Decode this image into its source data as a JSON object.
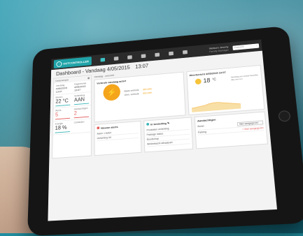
{
  "app": {
    "logo_text": "OUTCONTROLLER",
    "user_name": "Welkom Jeremy",
    "user_sub": "Family Manager",
    "search_placeholder": "Zoekveld"
  },
  "title": {
    "text": "Dashboard - Vandaag 4/05/2015",
    "time": "13:07"
  },
  "left": {
    "header": "Onderwerpen",
    "cells": [
      {
        "label": "Vandaag",
        "value": "4/05/2015 13:07"
      },
      {
        "label": "Dagschema",
        "value": "4/05/2015 13:07"
      },
      {
        "label": "Binnen",
        "value": "22 °C"
      },
      {
        "label": "Verlichting",
        "value": "AAN"
      },
      {
        "label": "Alerts",
        "value": "5"
      },
      {
        "label": "Aandachtigen",
        "value": "2"
      },
      {
        "label": "Energie",
        "value": "18 %"
      },
      {
        "label": "Contacten",
        "value": ""
      }
    ]
  },
  "main": {
    "header_left": "Vandaag - overzicht",
    "energy": {
      "title": "Verbruik vandaag actief",
      "row1_label": "Basis verbruik",
      "row1_value": "350 kWh",
      "row2_label": "Gem. verbruik",
      "row2_value": "590 kWh"
    },
    "weather": {
      "title": "Weerbericht 4/05/2015 13:07",
      "temp": "18",
      "desc": "Vandaag een ietwat bewolkte dag met zon"
    },
    "alerts": {
      "title": "Nieuwe alerts",
      "items": [
        "Alarm 1 Actief",
        "Verlichting Uit"
      ]
    },
    "settings": {
      "title": "In bestelling",
      "items": [
        "Produkten verlichting",
        "Package status",
        "Boodschap",
        "Winkelwacht afhaalpunt"
      ]
    },
    "notices": {
      "title": "Aandachtigen",
      "rows": [
        {
          "label": "Boner",
          "select": "Niet aangegeven"
        },
        {
          "label": "Parking",
          "link": "+ Niet aangegeven"
        }
      ]
    }
  },
  "chart_data": {
    "type": "area",
    "values": [
      6,
      7,
      8,
      9,
      11,
      12,
      12,
      11,
      10,
      9,
      8,
      7
    ]
  }
}
